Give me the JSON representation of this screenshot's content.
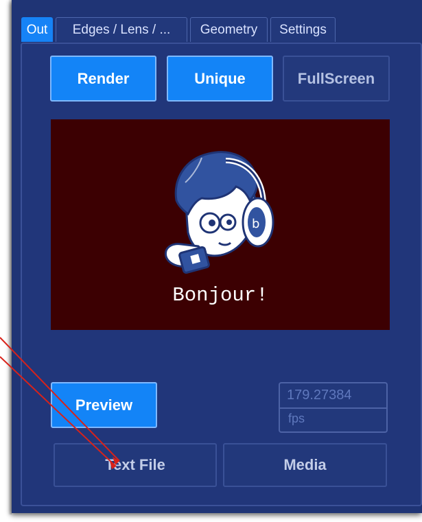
{
  "tabs": [
    {
      "label": "Out",
      "active": true
    },
    {
      "label": "Edges / Lens / ...",
      "active": false
    },
    {
      "label": "Geometry",
      "active": false
    },
    {
      "label": "Settings",
      "active": false
    }
  ],
  "toolbar": {
    "render_label": "Render",
    "unique_label": "Unique",
    "fullscreen_label": "FullScreen"
  },
  "preview": {
    "image_caption": "Bonjour!",
    "background_color": "#3c0002"
  },
  "bottom": {
    "preview_label": "Preview",
    "fps_value": "179.27384",
    "fps_unit": "fps",
    "text_file_label": "Text File",
    "media_label": "Media"
  },
  "colors": {
    "window_bg": "#1f3475",
    "accent": "#1384f7",
    "annotation_arrow": "#d8221a"
  },
  "icons": {
    "preview_image": "headphones-character-icon"
  }
}
